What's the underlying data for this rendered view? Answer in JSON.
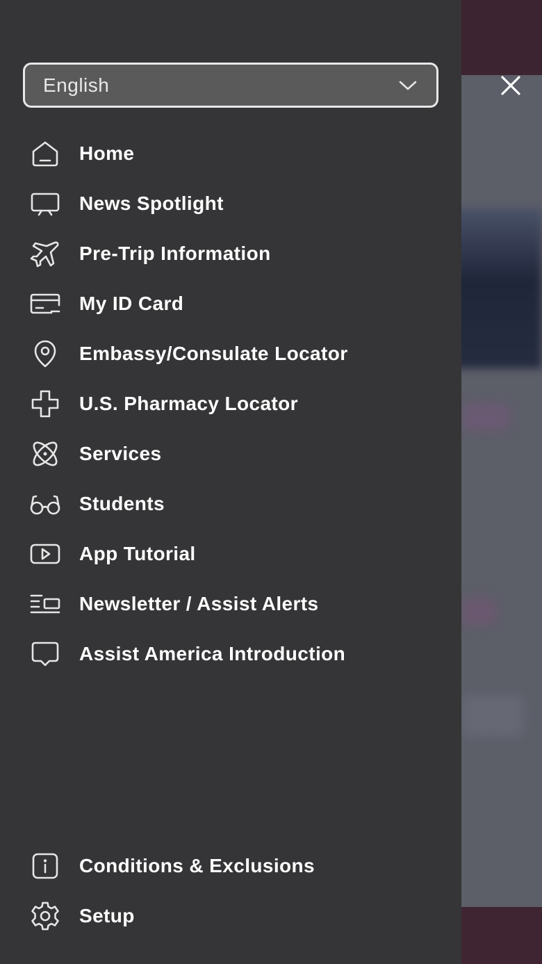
{
  "language_select": {
    "value": "English"
  },
  "menu": {
    "items": [
      {
        "label": "Home",
        "icon": "home-icon"
      },
      {
        "label": "News Spotlight",
        "icon": "presentation-icon"
      },
      {
        "label": "Pre-Trip Information",
        "icon": "airplane-icon"
      },
      {
        "label": "My ID Card",
        "icon": "id-card-icon"
      },
      {
        "label": "Embassy/Consulate Locator",
        "icon": "location-pin-icon"
      },
      {
        "label": "U.S. Pharmacy Locator",
        "icon": "medical-cross-icon"
      },
      {
        "label": "Services",
        "icon": "atom-icon"
      },
      {
        "label": "Students",
        "icon": "glasses-icon"
      },
      {
        "label": "App Tutorial",
        "icon": "video-play-icon"
      },
      {
        "label": "Newsletter / Assist Alerts",
        "icon": "newsletter-icon"
      },
      {
        "label": "Assist America Introduction",
        "icon": "chat-bubble-icon"
      }
    ],
    "bottom_items": [
      {
        "label": "Conditions & Exclusions",
        "icon": "info-icon"
      },
      {
        "label": "Setup",
        "icon": "gear-icon"
      }
    ]
  },
  "colors": {
    "drawer_background": "#353436",
    "text": "#ffffff",
    "icon_stroke": "#e6e6e6",
    "select_background": "#5a5a5b"
  }
}
